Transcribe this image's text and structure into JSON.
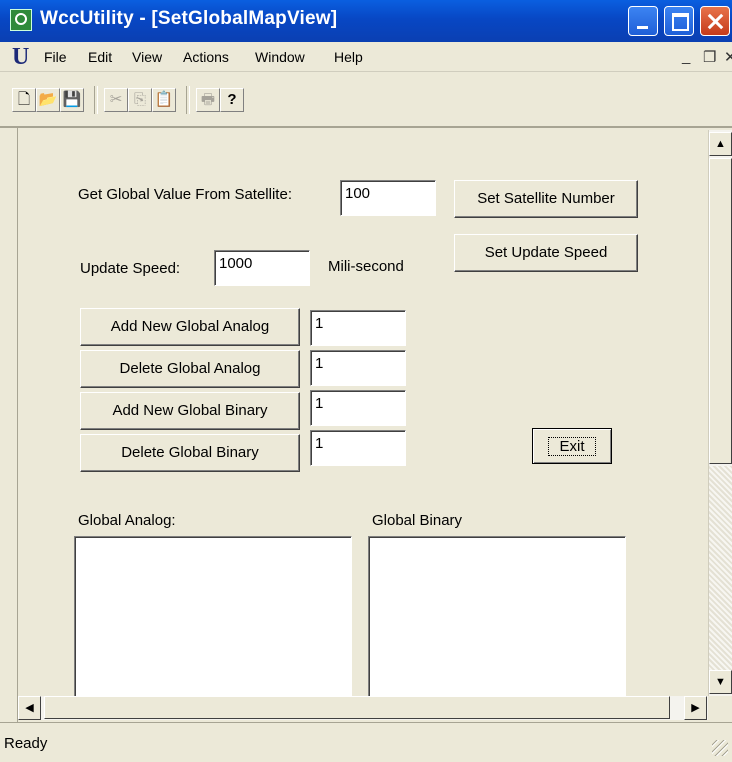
{
  "window": {
    "title": "WccUtility - [SetGlobalMapView]",
    "doc_icon": "U"
  },
  "menu": [
    "File",
    "Edit",
    "View",
    "Actions",
    "Window",
    "Help"
  ],
  "mdi_controls": {
    "minimize": "_",
    "restore": "❐",
    "close": "✕"
  },
  "toolbar": {
    "icons": [
      "new-file-icon",
      "open-folder-icon",
      "save-icon",
      "cut-icon",
      "copy-icon",
      "paste-icon",
      "print-icon",
      "help-icon"
    ],
    "glyphs": {
      "new": "🗋",
      "open": "📂",
      "save": "💾",
      "cut": "✂",
      "copy": "⎘",
      "paste": "📋",
      "print": "🖶",
      "help": "?"
    }
  },
  "form": {
    "satellite_label": "Get Global Value From Satellite:",
    "satellite_value": "100",
    "set_satellite_button": "Set Satellite Number",
    "update_label": "Update Speed:",
    "update_value": "1000",
    "update_unit": "Mili-second",
    "set_update_button": "Set Update Speed",
    "actions": [
      {
        "label": "Add New Global Analog",
        "value": "1"
      },
      {
        "label": "Delete Global Analog",
        "value": "1"
      },
      {
        "label": "Add New Global Binary",
        "value": "1"
      },
      {
        "label": "Delete Global Binary",
        "value": "1"
      }
    ],
    "exit_button": "Exit",
    "analog_list_label": "Global Analog:",
    "binary_list_label": "Global Binary"
  },
  "scroll": {
    "up": "▲",
    "down": "▼",
    "left": "◀",
    "right": "▶"
  },
  "status": {
    "text": "Ready"
  }
}
